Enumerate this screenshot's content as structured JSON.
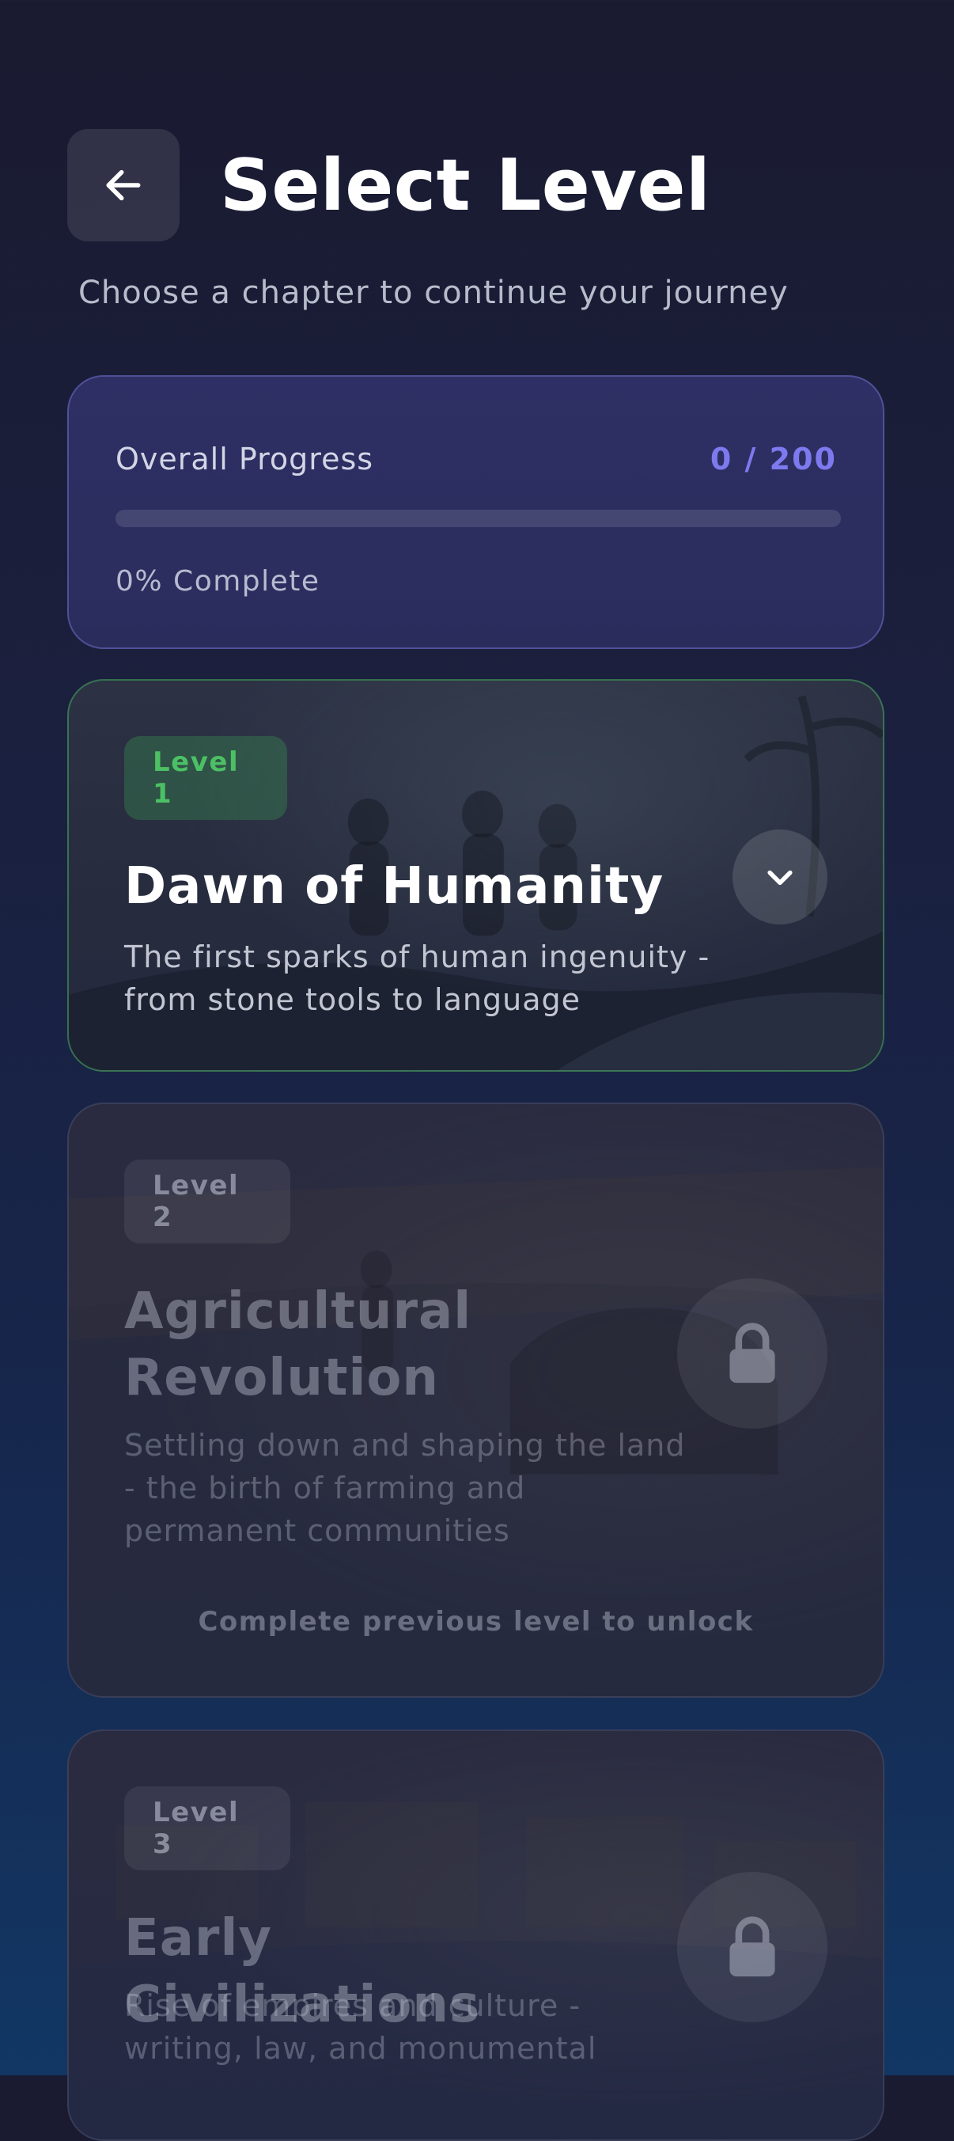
{
  "header": {
    "back_icon": "arrow-left-icon",
    "title": "Select Level",
    "subtitle": "Choose a chapter to continue your journey"
  },
  "progress": {
    "label": "Overall Progress",
    "count": "0 / 200",
    "fraction": 0,
    "percent_text": "0% Complete",
    "accent_color": "#7d79ee"
  },
  "levels": [
    {
      "badge": "Level 1",
      "title": "Dawn of Humanity",
      "description": "The first sparks of human ingenuity - from stone tools to language",
      "state": "unlocked",
      "action_icon": "chevron-down-icon",
      "badge_color": "#4cc064"
    },
    {
      "badge": "Level 2",
      "title": "Agricultural Revolution",
      "description": "Settling down and shaping the land - the birth of farming and permanent communities",
      "state": "locked",
      "action_icon": "lock-icon",
      "hint": "Complete previous level to unlock"
    },
    {
      "badge": "Level 3",
      "title": "Early Civilizations",
      "description": "Rise of empires and culture - writing, law, and monumental",
      "state": "locked",
      "action_icon": "lock-icon"
    }
  ]
}
